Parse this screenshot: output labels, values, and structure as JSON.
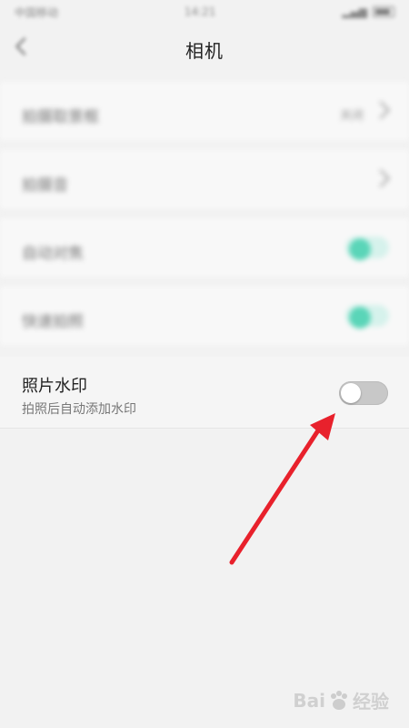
{
  "status_bar": {
    "carrier": "中国移动",
    "time": "14:21"
  },
  "header": {
    "title": "相机"
  },
  "blurred_rows": [
    {
      "label": "拍摄取景框",
      "value": "关闭"
    },
    {
      "label": "拍摄音"
    },
    {
      "label": "自动对焦"
    },
    {
      "label": "快速拍照"
    }
  ],
  "watermark_setting": {
    "title": "照片水印",
    "subtitle": "拍照后自动添加水印",
    "enabled": false
  },
  "watermark": {
    "text_left": "Bai",
    "text_right": "经验"
  },
  "colors": {
    "accent": "#5ad5b8",
    "arrow": "#e8212c",
    "toggle_off": "#c8c8c8"
  }
}
